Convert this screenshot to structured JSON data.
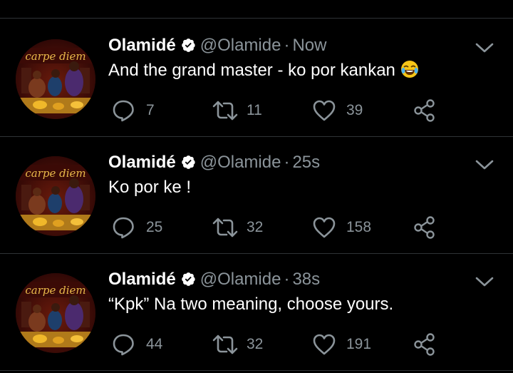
{
  "colors": {
    "background": "#000000",
    "text": "#ffffff",
    "muted": "#8b949a",
    "divider": "#2f3336",
    "verified": "#ffffff"
  },
  "tweets": [
    {
      "avatar_text": "carpe diem",
      "name": "Olamidé",
      "handle": "@Olamide",
      "separator": "·",
      "time": "Now",
      "text": "And the grand master - ko por kankan",
      "emoji": "face-with-tears-of-joy",
      "replies": "7",
      "retweets": "11",
      "likes": "39"
    },
    {
      "avatar_text": "carpe diem",
      "name": "Olamidé",
      "handle": "@Olamide",
      "separator": "·",
      "time": "25s",
      "text": "Ko por ke !",
      "replies": "25",
      "retweets": "32",
      "likes": "158"
    },
    {
      "avatar_text": "carpe diem",
      "name": "Olamidé",
      "handle": "@Olamide",
      "separator": "·",
      "time": "38s",
      "text": "“Kpk” Na two meaning, choose yours.",
      "replies": "44",
      "retweets": "32",
      "likes": "191"
    }
  ],
  "icons": {
    "reply": "comment-bubble-icon",
    "retweet": "retweet-arrows-icon",
    "like": "heart-outline-icon",
    "share": "share-nodes-icon",
    "menu": "chevron-down-icon",
    "verified": "verified-badge-icon"
  }
}
